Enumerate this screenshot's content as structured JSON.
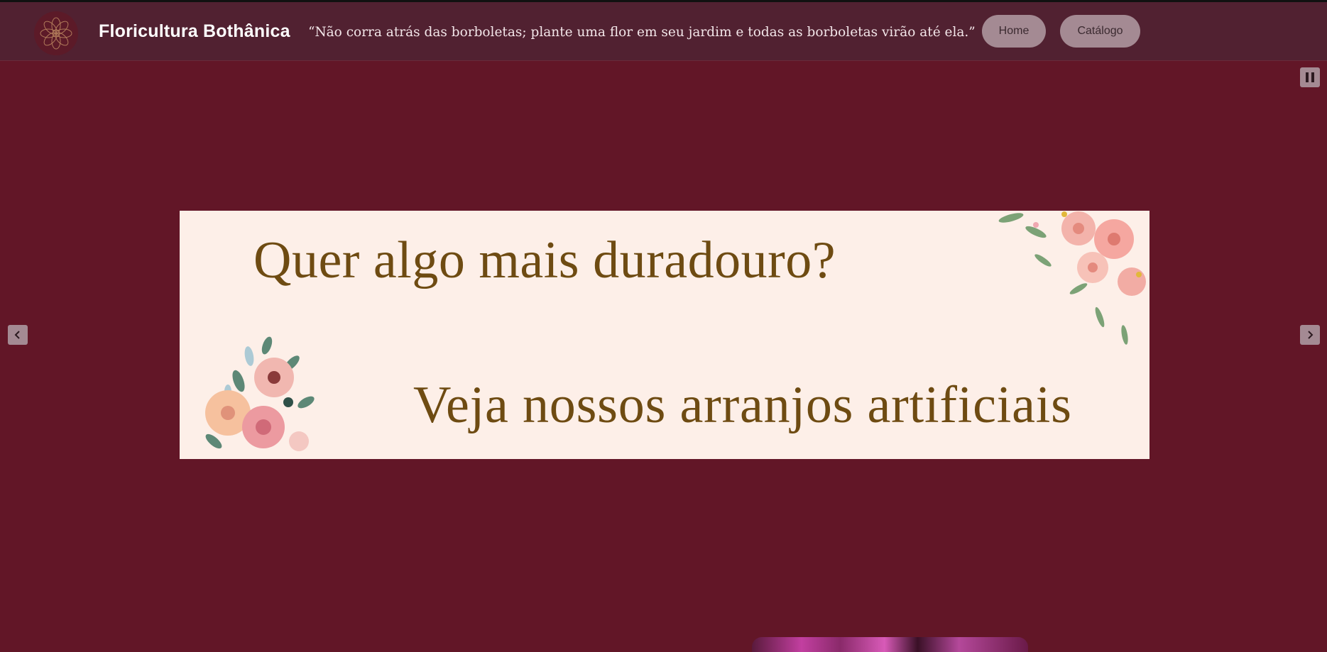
{
  "header": {
    "brand": "Floricultura Bothânica",
    "quote": "“Não corra atrás das borboletas; plante uma flor em seu jardim e todas as borboletas virão até ela.”",
    "nav": {
      "home": "Home",
      "catalog": "Catálogo"
    }
  },
  "carousel": {
    "headline": "Quer algo mais duradouro?",
    "subline": "Veja nossos arranjos artificiais"
  },
  "icons": {
    "logo": "flower-logo-icon",
    "pause": "pause-icon",
    "prev": "chevron-left-icon",
    "next": "chevron-right-icon"
  },
  "colors": {
    "page_background": "#621627",
    "header_background": "#512131",
    "button_background": "#a48a93",
    "banner_background": "#fdefe8",
    "banner_text": "#6e4b12"
  }
}
